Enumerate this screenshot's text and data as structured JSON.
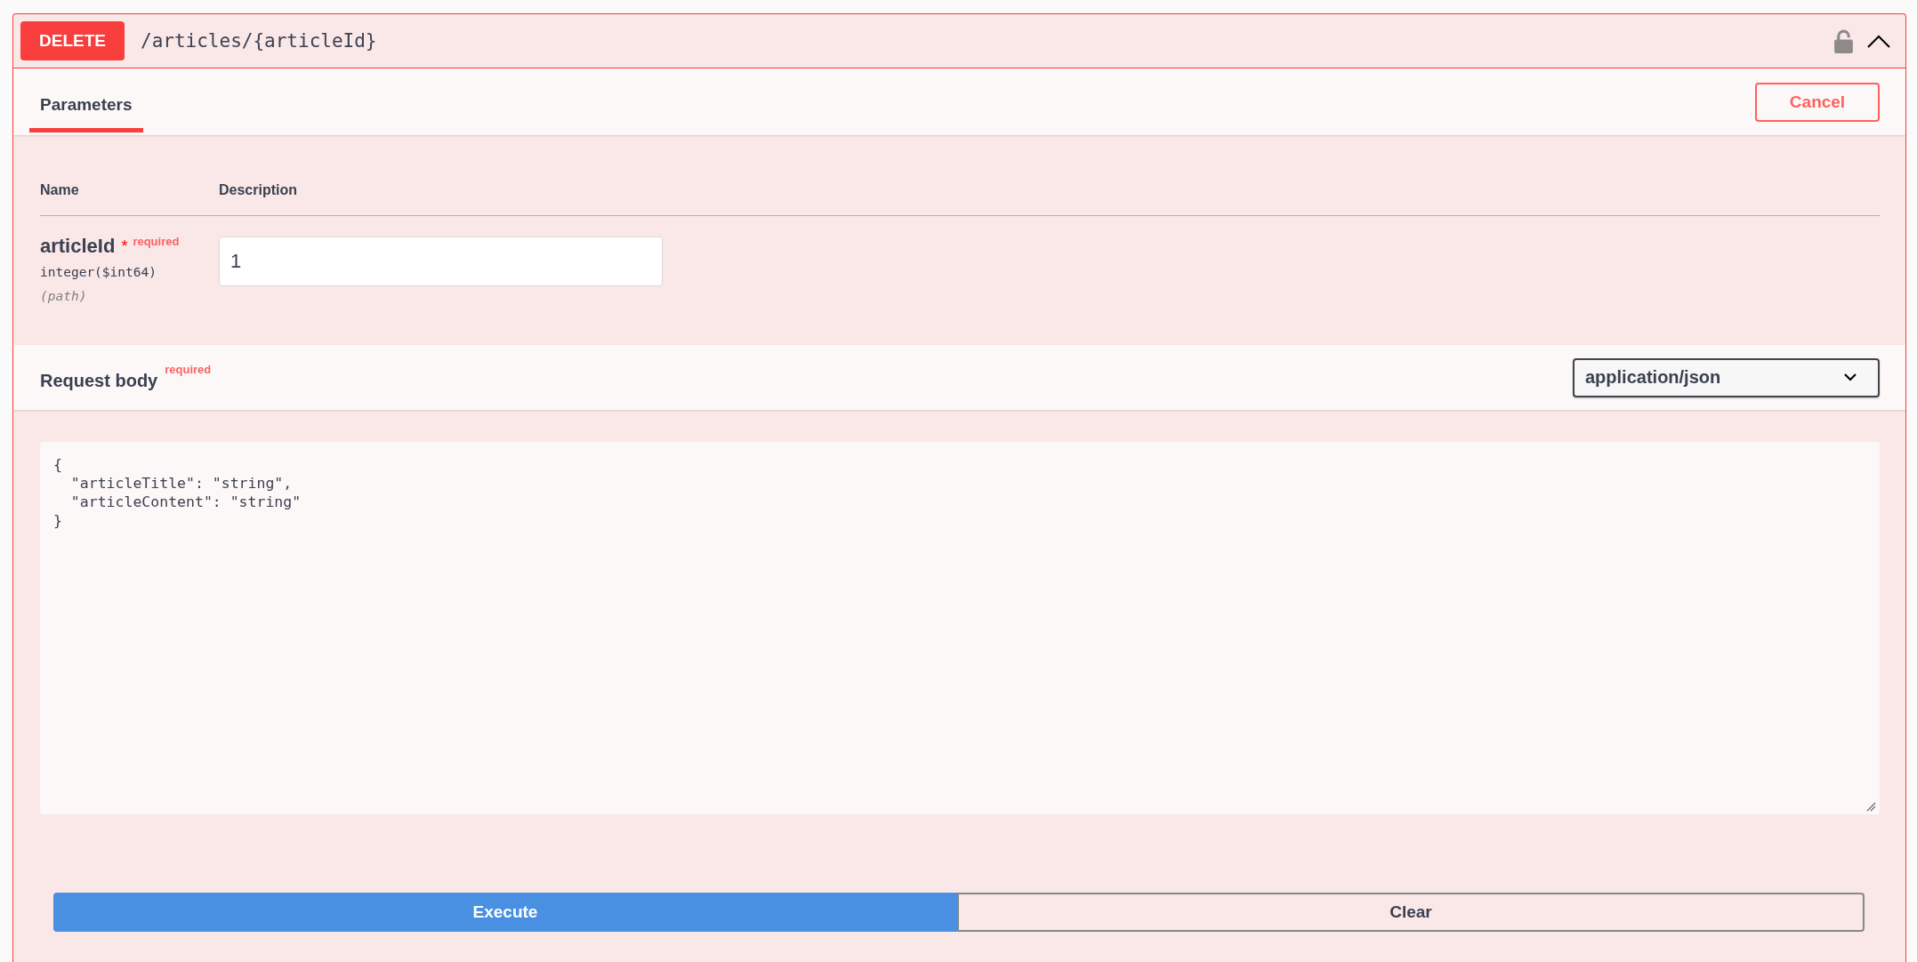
{
  "operation": {
    "method": "DELETE",
    "path": "/articles/{articleId}",
    "locked": false,
    "expanded": true
  },
  "tabs": [
    {
      "label": "Parameters",
      "selected": true
    }
  ],
  "cancel_button": "Cancel",
  "parameters": {
    "columns": [
      "Name",
      "Description"
    ],
    "rows": [
      {
        "name": "articleId",
        "required_mark": "*",
        "required_label": "required",
        "type": "integer($int64)",
        "location": "(path)",
        "value": "1"
      }
    ]
  },
  "request_body": {
    "title": "Request body",
    "required_label": "required",
    "content_type": "application/json",
    "code": [
      "{",
      "  \"articleTitle\": \"string\",",
      "  \"articleContent\": \"string\"",
      "}"
    ]
  },
  "buttons": [
    {
      "label": "Execute",
      "kind": "primary"
    },
    {
      "label": "Clear",
      "kind": "secondary"
    }
  ]
}
